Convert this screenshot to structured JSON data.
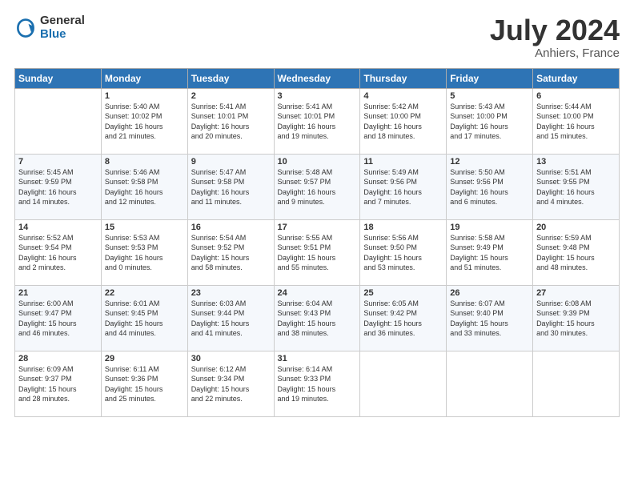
{
  "logo": {
    "general": "General",
    "blue": "Blue"
  },
  "title": "July 2024",
  "location": "Anhiers, France",
  "headers": [
    "Sunday",
    "Monday",
    "Tuesday",
    "Wednesday",
    "Thursday",
    "Friday",
    "Saturday"
  ],
  "weeks": [
    [
      {
        "day": "",
        "content": ""
      },
      {
        "day": "1",
        "content": "Sunrise: 5:40 AM\nSunset: 10:02 PM\nDaylight: 16 hours\nand 21 minutes."
      },
      {
        "day": "2",
        "content": "Sunrise: 5:41 AM\nSunset: 10:01 PM\nDaylight: 16 hours\nand 20 minutes."
      },
      {
        "day": "3",
        "content": "Sunrise: 5:41 AM\nSunset: 10:01 PM\nDaylight: 16 hours\nand 19 minutes."
      },
      {
        "day": "4",
        "content": "Sunrise: 5:42 AM\nSunset: 10:00 PM\nDaylight: 16 hours\nand 18 minutes."
      },
      {
        "day": "5",
        "content": "Sunrise: 5:43 AM\nSunset: 10:00 PM\nDaylight: 16 hours\nand 17 minutes."
      },
      {
        "day": "6",
        "content": "Sunrise: 5:44 AM\nSunset: 10:00 PM\nDaylight: 16 hours\nand 15 minutes."
      }
    ],
    [
      {
        "day": "7",
        "content": "Sunrise: 5:45 AM\nSunset: 9:59 PM\nDaylight: 16 hours\nand 14 minutes."
      },
      {
        "day": "8",
        "content": "Sunrise: 5:46 AM\nSunset: 9:58 PM\nDaylight: 16 hours\nand 12 minutes."
      },
      {
        "day": "9",
        "content": "Sunrise: 5:47 AM\nSunset: 9:58 PM\nDaylight: 16 hours\nand 11 minutes."
      },
      {
        "day": "10",
        "content": "Sunrise: 5:48 AM\nSunset: 9:57 PM\nDaylight: 16 hours\nand 9 minutes."
      },
      {
        "day": "11",
        "content": "Sunrise: 5:49 AM\nSunset: 9:56 PM\nDaylight: 16 hours\nand 7 minutes."
      },
      {
        "day": "12",
        "content": "Sunrise: 5:50 AM\nSunset: 9:56 PM\nDaylight: 16 hours\nand 6 minutes."
      },
      {
        "day": "13",
        "content": "Sunrise: 5:51 AM\nSunset: 9:55 PM\nDaylight: 16 hours\nand 4 minutes."
      }
    ],
    [
      {
        "day": "14",
        "content": "Sunrise: 5:52 AM\nSunset: 9:54 PM\nDaylight: 16 hours\nand 2 minutes."
      },
      {
        "day": "15",
        "content": "Sunrise: 5:53 AM\nSunset: 9:53 PM\nDaylight: 16 hours\nand 0 minutes."
      },
      {
        "day": "16",
        "content": "Sunrise: 5:54 AM\nSunset: 9:52 PM\nDaylight: 15 hours\nand 58 minutes."
      },
      {
        "day": "17",
        "content": "Sunrise: 5:55 AM\nSunset: 9:51 PM\nDaylight: 15 hours\nand 55 minutes."
      },
      {
        "day": "18",
        "content": "Sunrise: 5:56 AM\nSunset: 9:50 PM\nDaylight: 15 hours\nand 53 minutes."
      },
      {
        "day": "19",
        "content": "Sunrise: 5:58 AM\nSunset: 9:49 PM\nDaylight: 15 hours\nand 51 minutes."
      },
      {
        "day": "20",
        "content": "Sunrise: 5:59 AM\nSunset: 9:48 PM\nDaylight: 15 hours\nand 48 minutes."
      }
    ],
    [
      {
        "day": "21",
        "content": "Sunrise: 6:00 AM\nSunset: 9:47 PM\nDaylight: 15 hours\nand 46 minutes."
      },
      {
        "day": "22",
        "content": "Sunrise: 6:01 AM\nSunset: 9:45 PM\nDaylight: 15 hours\nand 44 minutes."
      },
      {
        "day": "23",
        "content": "Sunrise: 6:03 AM\nSunset: 9:44 PM\nDaylight: 15 hours\nand 41 minutes."
      },
      {
        "day": "24",
        "content": "Sunrise: 6:04 AM\nSunset: 9:43 PM\nDaylight: 15 hours\nand 38 minutes."
      },
      {
        "day": "25",
        "content": "Sunrise: 6:05 AM\nSunset: 9:42 PM\nDaylight: 15 hours\nand 36 minutes."
      },
      {
        "day": "26",
        "content": "Sunrise: 6:07 AM\nSunset: 9:40 PM\nDaylight: 15 hours\nand 33 minutes."
      },
      {
        "day": "27",
        "content": "Sunrise: 6:08 AM\nSunset: 9:39 PM\nDaylight: 15 hours\nand 30 minutes."
      }
    ],
    [
      {
        "day": "28",
        "content": "Sunrise: 6:09 AM\nSunset: 9:37 PM\nDaylight: 15 hours\nand 28 minutes."
      },
      {
        "day": "29",
        "content": "Sunrise: 6:11 AM\nSunset: 9:36 PM\nDaylight: 15 hours\nand 25 minutes."
      },
      {
        "day": "30",
        "content": "Sunrise: 6:12 AM\nSunset: 9:34 PM\nDaylight: 15 hours\nand 22 minutes."
      },
      {
        "day": "31",
        "content": "Sunrise: 6:14 AM\nSunset: 9:33 PM\nDaylight: 15 hours\nand 19 minutes."
      },
      {
        "day": "",
        "content": ""
      },
      {
        "day": "",
        "content": ""
      },
      {
        "day": "",
        "content": ""
      }
    ]
  ]
}
